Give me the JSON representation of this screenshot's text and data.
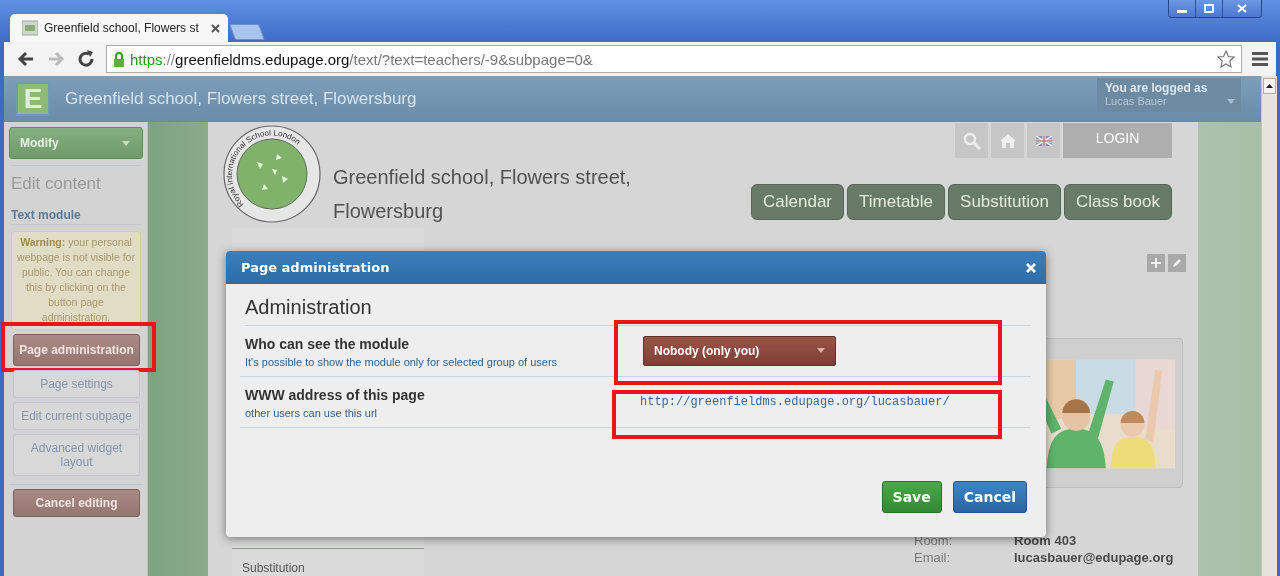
{
  "browser": {
    "tabs": [
      {
        "title": "Greenfield school, Flowers st",
        "selected": true
      }
    ],
    "address": {
      "scheme": "https",
      "separator": "://",
      "host": "greenfieldms.edupage.org",
      "path": "/text/?text=teachers/-9&subpage=0&"
    }
  },
  "site_header": {
    "logo": "E",
    "title": "Greenfield school, Flowers street, Flowersburg",
    "login_label": "You are logged as",
    "user": "Lucas Bauer"
  },
  "sidebar": {
    "menu_button": "Modify",
    "heading": "Edit content",
    "section": "Text module",
    "warning": "**Warning:** your personal webpage is not visible for public. You can change this by clicking on the button page administration.",
    "buttons": [
      {
        "label": "Page administration",
        "kind": "primary",
        "highlighted": true
      },
      {
        "label": "Page settings",
        "kind": "plain",
        "highlighted": false
      },
      {
        "label": "Edit current subpage",
        "kind": "plain",
        "highlighted": false
      },
      {
        "label": "Advanced widget layout",
        "kind": "plain",
        "highlighted": false
      },
      {
        "label": "Cancel editing",
        "kind": "primary",
        "highlighted": false
      }
    ]
  },
  "page": {
    "logo_text": "Royal International School London",
    "title": "Greenfield school, Flowers street, Flowersburg",
    "login": "LOGIN",
    "nav": [
      "Calendar",
      "Timetable",
      "Substitution",
      "Class book"
    ],
    "menu": [
      "Substitution"
    ],
    "details": [
      {
        "label": "Room:",
        "value": "Room 403"
      },
      {
        "label": "Email:",
        "value": "lucasbauer@edupage.org"
      }
    ]
  },
  "dialog": {
    "title": "Page administration",
    "heading": "Administration",
    "rows": [
      {
        "kind": "select",
        "label": "Who can see the module",
        "hint": "It's possible to show the module only for selected group of users",
        "value": "Nobody (only you)",
        "highlighted": true
      },
      {
        "kind": "link",
        "label": "WWW address of this page",
        "hint": "other users can use this url",
        "value": "http://greenfieldms.edupage.org/lucasbauer/",
        "highlighted": true
      }
    ],
    "buttons": [
      {
        "label": "Save",
        "kind": "save"
      },
      {
        "label": "Cancel",
        "kind": "cancel"
      }
    ]
  }
}
